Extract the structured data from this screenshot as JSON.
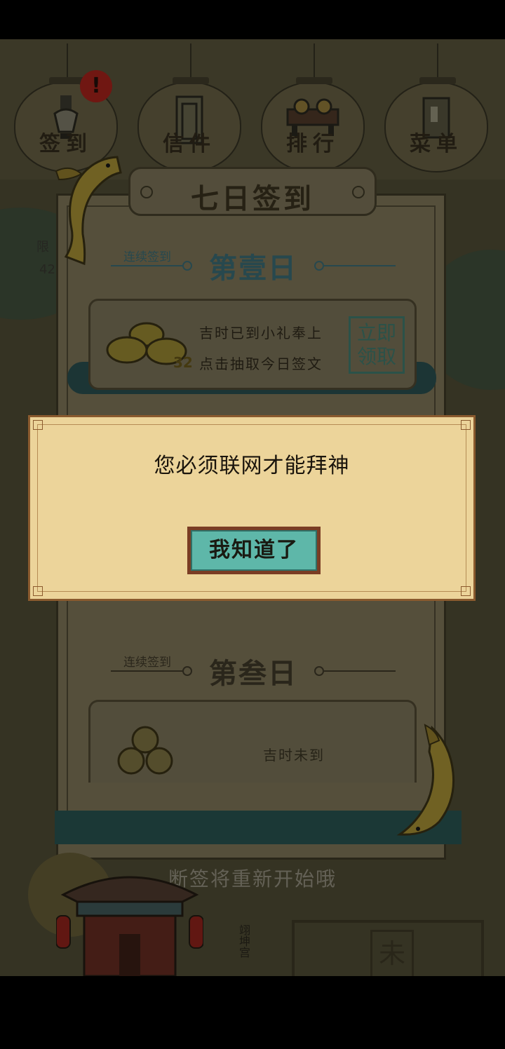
{
  "top_menu": [
    {
      "label": "签到",
      "icon": "lightbulb-icon",
      "badge": "!"
    },
    {
      "label": "信件",
      "icon": "door-icon"
    },
    {
      "label": "排行",
      "icon": "trophy-icon"
    },
    {
      "label": "菜单",
      "icon": "book-icon"
    }
  ],
  "panel": {
    "title": "七日签到",
    "day1": {
      "sub": "连续签到",
      "title": "第壹日",
      "line1": "吉时已到小礼奉上",
      "line2": "点击抽取今日签文",
      "count": "32",
      "stamp_top": "立即",
      "stamp_bottom": "领取"
    },
    "day3": {
      "sub": "连续签到",
      "title": "第叁日",
      "status": "吉时未到"
    },
    "footer": "断签将重新开始哦"
  },
  "side_text": {
    "left1": "限",
    "left2": "42",
    "temple_sign": "翊坤宫",
    "right_plaque": "未"
  },
  "dialog": {
    "message": "您必须联网才能拜神",
    "ok_label": "我知道了"
  },
  "colors": {
    "dialog_bg": "#ecd49a",
    "button": "#5eb7a9",
    "accent": "#2b4f55"
  }
}
